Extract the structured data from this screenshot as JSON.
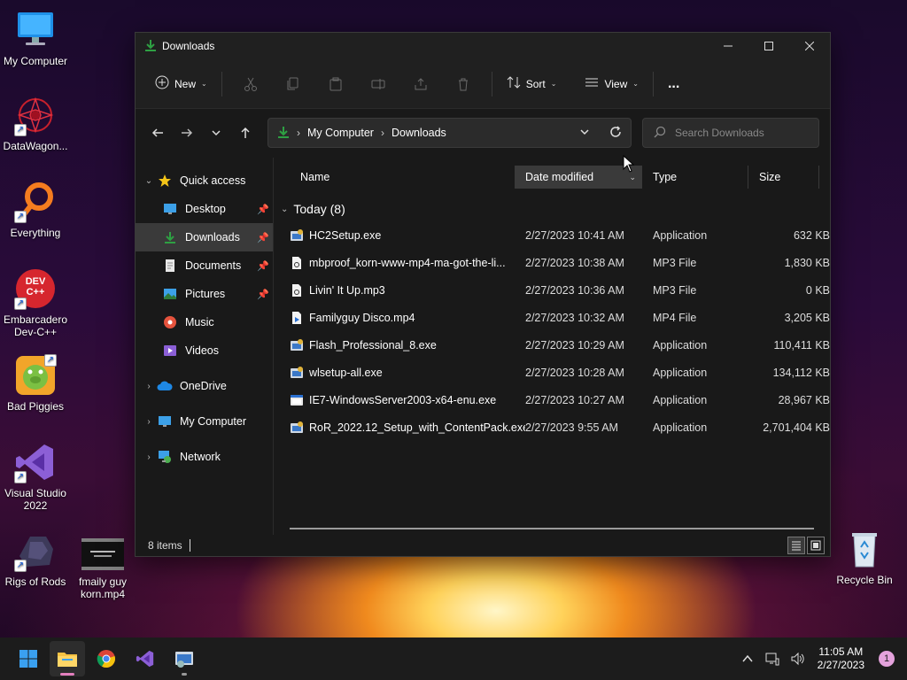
{
  "desktop": {
    "icons": [
      {
        "label": "My Computer"
      },
      {
        "label": "DataWagon..."
      },
      {
        "label": "Everything"
      },
      {
        "label": "Embarcadero Dev-C++",
        "line1": "Embarcadero",
        "line2": "Dev-C++"
      },
      {
        "label": "Bad Piggies"
      },
      {
        "label": "Visual Studio 2022",
        "line1": "Visual Studio",
        "line2": "2022"
      },
      {
        "label": "Rigs of Rods"
      },
      {
        "label": "fmaily guy korn.mp4",
        "line1": "fmaily guy",
        "line2": "korn.mp4"
      },
      {
        "label": "Recycle Bin"
      }
    ],
    "devcpp_badge": "DEV C++"
  },
  "window": {
    "title": "Downloads",
    "toolbar": {
      "new_label": "New",
      "sort_label": "Sort",
      "view_label": "View",
      "more_label": "..."
    },
    "address": {
      "crumbs": [
        "My Computer",
        "Downloads"
      ]
    },
    "search": {
      "placeholder": "Search Downloads"
    },
    "nav": {
      "quick_access": "Quick access",
      "items": [
        {
          "label": "Desktop",
          "pinned": true
        },
        {
          "label": "Downloads",
          "pinned": true,
          "selected": true
        },
        {
          "label": "Documents",
          "pinned": true
        },
        {
          "label": "Pictures",
          "pinned": true
        },
        {
          "label": "Music",
          "pinned": false
        },
        {
          "label": "Videos",
          "pinned": false
        }
      ],
      "onedrive": "OneDrive",
      "my_computer": "My Computer",
      "network": "Network"
    },
    "columns": {
      "name": "Name",
      "date": "Date modified",
      "type": "Type",
      "size": "Size"
    },
    "group": {
      "label": "Today (8)"
    },
    "files": [
      {
        "name": "HC2Setup.exe",
        "date": "2/27/2023 10:41 AM",
        "type": "Application",
        "size": "632 KB",
        "icon": "installer-icon"
      },
      {
        "name": "mbproof_korn-www-mp4-ma-got-the-li...",
        "date": "2/27/2023 10:38 AM",
        "type": "MP3 File",
        "size": "1,830 KB",
        "icon": "audio-file-icon"
      },
      {
        "name": "Livin' It Up.mp3",
        "date": "2/27/2023 10:36 AM",
        "type": "MP3 File",
        "size": "0 KB",
        "icon": "audio-file-icon"
      },
      {
        "name": "Familyguy Disco.mp4",
        "date": "2/27/2023 10:32 AM",
        "type": "MP4 File",
        "size": "3,205 KB",
        "icon": "video-file-icon"
      },
      {
        "name": "Flash_Professional_8.exe",
        "date": "2/27/2023 10:29 AM",
        "type": "Application",
        "size": "110,411 KB",
        "icon": "installer-icon"
      },
      {
        "name": "wlsetup-all.exe",
        "date": "2/27/2023 10:28 AM",
        "type": "Application",
        "size": "134,112 KB",
        "icon": "installer-icon"
      },
      {
        "name": "IE7-WindowsServer2003-x64-enu.exe",
        "date": "2/27/2023 10:27 AM",
        "type": "Application",
        "size": "28,967 KB",
        "icon": "app-window-icon"
      },
      {
        "name": "RoR_2022.12_Setup_with_ContentPack.exe",
        "date": "2/27/2023 9:55 AM",
        "type": "Application",
        "size": "2,701,404 KB",
        "icon": "installer-icon"
      }
    ],
    "status": {
      "count": "8 items"
    }
  },
  "taskbar": {
    "clock_time": "11:05 AM",
    "clock_date": "2/27/2023",
    "notifications": "1"
  },
  "colors": {
    "accent_green": "#2ea043",
    "selection": "#3a3a3a",
    "window_bg": "#191919"
  }
}
